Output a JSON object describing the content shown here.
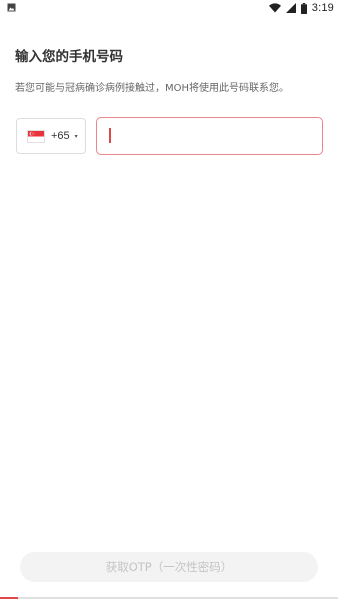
{
  "status_bar": {
    "time": "3:19",
    "left_icon": "image-notification-icon",
    "icons": [
      "wifi-icon",
      "cellular-signal-icon",
      "battery-icon"
    ]
  },
  "page": {
    "title": "输入您的手机号码",
    "description": "若您可能与冠病确诊病例接触过，MOH将使用此号码联系您。"
  },
  "phone": {
    "country_flag": "singapore-flag-icon",
    "country_code": "+65",
    "value": "",
    "placeholder": ""
  },
  "actions": {
    "otp_button_label": "获取OTP（一次性密码）",
    "otp_button_enabled": false
  },
  "colors": {
    "accent": "#e04848",
    "input_border": "#e8868a",
    "disabled_button_bg": "#f3f3f3",
    "disabled_button_text": "#c4c4c4"
  }
}
